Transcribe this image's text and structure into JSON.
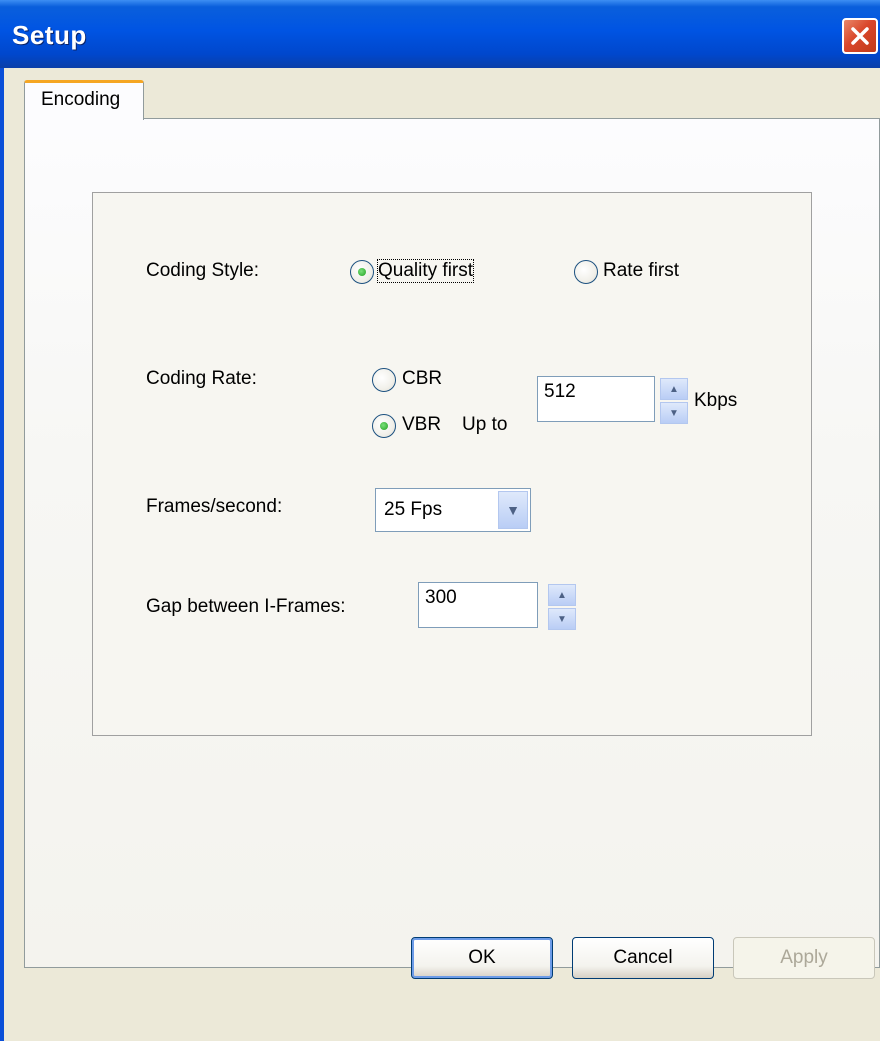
{
  "window": {
    "title": "Setup"
  },
  "tabs": [
    {
      "label": "Encoding"
    }
  ],
  "coding_style": {
    "label": "Coding Style:",
    "options": [
      {
        "label": "Quality first",
        "selected": true
      },
      {
        "label": "Rate first",
        "selected": false
      }
    ]
  },
  "coding_rate": {
    "label": "Coding Rate:",
    "cbr_label": "CBR",
    "vbr_label": "VBR",
    "upto_label": "Up to",
    "selected": "VBR",
    "value": "512",
    "unit": "Kbps"
  },
  "frames": {
    "label": "Frames/second:",
    "value": "25  Fps"
  },
  "gap": {
    "label": "Gap between I-Frames:",
    "value": "300"
  },
  "buttons": {
    "ok": "OK",
    "cancel": "Cancel",
    "apply": "Apply"
  },
  "colors": {
    "titlebar": "#0054e3",
    "tab_accent": "#f5a623",
    "radio_dot": "#21a121",
    "close": "#d9462a"
  },
  "icons": {
    "close": "close-icon",
    "spin_up": "chevron-up-icon",
    "spin_down": "chevron-down-icon",
    "dropdown": "chevron-down-icon"
  }
}
